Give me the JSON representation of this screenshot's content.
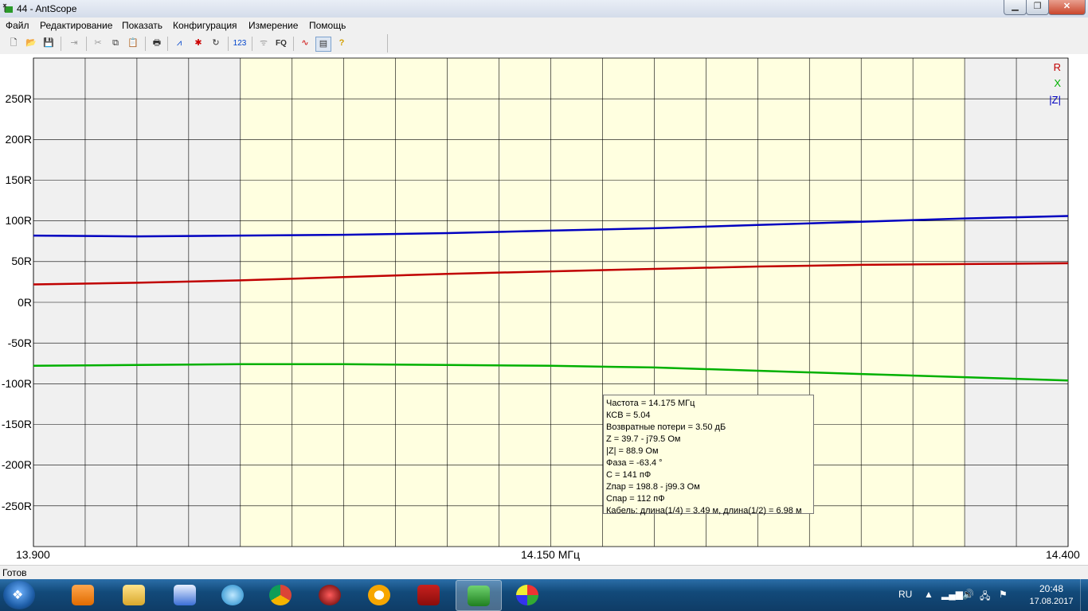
{
  "window": {
    "title": "44 - AntScope"
  },
  "menu": [
    "Файл",
    "Редактирование",
    "Показать",
    "Конфигурация",
    "Измерение",
    "Помощь"
  ],
  "toolbar": {
    "icons": [
      "new-icon",
      "open-icon",
      "save-icon",
      "export-icon",
      "cut-icon",
      "copy-icon",
      "paste-icon",
      "print-icon",
      "chart-icon",
      "sweep-icon",
      "refresh-icon",
      "numeric-icon",
      "antenna-icon",
      "fq-icon",
      "dual-chart-icon",
      "table-icon",
      "help-icon"
    ],
    "numeric_label": "123",
    "fq_label": "FQ"
  },
  "legend": {
    "r": "R",
    "x": "X",
    "z": "|Z|"
  },
  "colors": {
    "r": "#c00000",
    "x": "#00b000",
    "z": "#0000c0",
    "band": "#ffffe0",
    "outside": "#f0f0f0"
  },
  "chart_data": {
    "type": "line",
    "x_range": [
      13.9,
      14.4
    ],
    "ylim": [
      -300,
      300
    ],
    "y_ticks": [
      "250R",
      "200R",
      "150R",
      "100R",
      "50R",
      "0R",
      "-50R",
      "-100R",
      "-150R",
      "-200R",
      "-250R"
    ],
    "x_tick_labels": {
      "left": "13.900",
      "center": "14.150 МГц",
      "right": "14.400"
    },
    "band_highlight": [
      14.0,
      14.35
    ],
    "x": [
      13.9,
      13.95,
      14.0,
      14.05,
      14.1,
      14.15,
      14.2,
      14.25,
      14.3,
      14.35,
      14.4
    ],
    "series": [
      {
        "name": "R",
        "values": [
          22,
          24,
          27,
          31,
          35,
          38,
          41,
          44,
          46,
          47,
          48
        ]
      },
      {
        "name": "X",
        "values": [
          -78,
          -77,
          -76,
          -76,
          -77,
          -78,
          -80,
          -84,
          -88,
          -92,
          -96
        ]
      },
      {
        "name": "|Z|",
        "values": [
          82,
          81,
          82,
          83,
          85,
          88,
          91,
          95,
          99,
          103,
          106
        ]
      }
    ]
  },
  "info": {
    "lines": [
      "Частота = 14.175 МГц",
      "КСВ = 5.04",
      "Возвратные потери = 3.50 дБ",
      "Z = 39.7 - j79.5 Ом",
      "|Z| = 88.9 Ом",
      "Фаза = -63.4 °",
      "C = 141 пФ",
      "Zпар = 198.8 - j99.3 Ом",
      "Cпар = 112 пФ",
      "Кабель: длина(1/4) = 3.49 м, длина(1/2) = 6.98 м"
    ]
  },
  "status": {
    "text": "Готов"
  },
  "taskbar": {
    "apps": [
      "media-player-icon",
      "file-explorer-icon",
      "network-app-icon",
      "browser-app-icon",
      "chrome-icon",
      "security-app-icon",
      "mail-agent-icon",
      "pdf-reader-icon",
      "antscope-icon",
      "paint-icon"
    ],
    "lang": "RU",
    "time": "20:48",
    "date": "17.08.2017"
  }
}
